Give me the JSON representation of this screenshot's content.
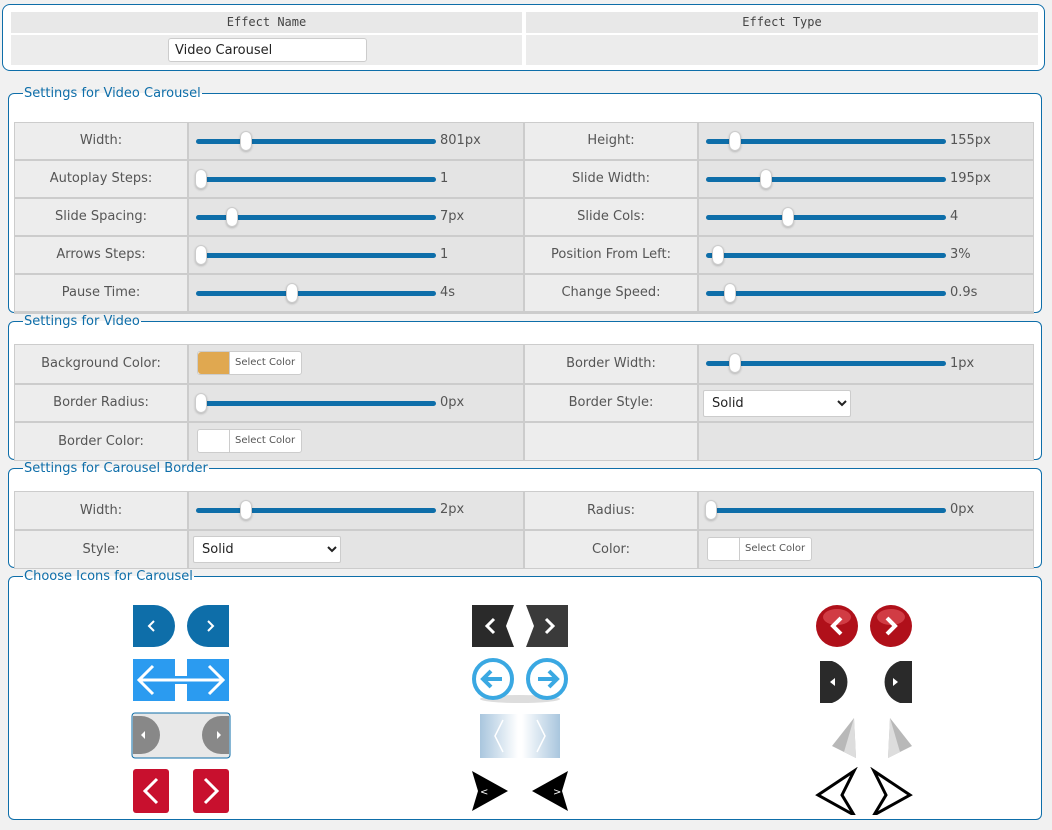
{
  "top": {
    "col1_header": "Effect Name",
    "col2_header": "Effect Type",
    "effect_name": "Video Carousel",
    "effect_type": ""
  },
  "carousel": {
    "legend": "Settings for Video Carousel",
    "rows": [
      {
        "l_label": "Width:",
        "l_value": "801px",
        "l_pos": 0.21,
        "r_label": "Height:",
        "r_value": "155px",
        "r_pos": 0.12
      },
      {
        "l_label": "Autoplay Steps:",
        "l_value": "1",
        "l_pos": 0.02,
        "r_label": "Slide Width:",
        "r_value": "195px",
        "r_pos": 0.25
      },
      {
        "l_label": "Slide Spacing:",
        "l_value": "7px",
        "l_pos": 0.15,
        "r_label": "Slide Cols:",
        "r_value": "4",
        "r_pos": 0.34
      },
      {
        "l_label": "Arrows Steps:",
        "l_value": "1",
        "l_pos": 0.02,
        "r_label": "Position From Left:",
        "r_value": "3%",
        "r_pos": 0.05
      },
      {
        "l_label": "Pause Time:",
        "l_value": "4s",
        "l_pos": 0.4,
        "r_label": "Change Speed:",
        "r_value": "0.9s",
        "r_pos": 0.1
      }
    ]
  },
  "video": {
    "legend": "Settings for Video",
    "bg_label": "Background Color:",
    "bg_color": "#e0a850",
    "select_color": "Select Color",
    "bw_label": "Border Width:",
    "bw_value": "1px",
    "bw_pos": 0.12,
    "br_label": "Border Radius:",
    "br_value": "0px",
    "br_pos": 0.02,
    "bs_label": "Border Style:",
    "bs_value": "Solid",
    "bc_label": "Border Color:",
    "bc_color": "#ffffff"
  },
  "border": {
    "legend": "Settings for Carousel Border",
    "w_label": "Width:",
    "w_value": "2px",
    "w_pos": 0.21,
    "r_label": "Radius:",
    "r_value": "0px",
    "r_pos": 0.02,
    "s_label": "Style:",
    "s_value": "Solid",
    "c_label": "Color:",
    "c_color": "#ffffff"
  },
  "icons": {
    "legend": "Choose Icons for Carousel",
    "items": [
      "blue-rounded-arrows-icon",
      "black-chevron-arrows-icon",
      "red-glossy-circle-arrows-icon",
      "blue-long-arrows-icon",
      "blue-circle-arrows-icon",
      "black-half-round-arrows-icon",
      "gray-half-circle-arrows-icon",
      "light-blue-thin-arrows-icon",
      "thin-gray-needle-arrows-icon",
      "red-square-arrows-icon",
      "black-triangle-arrows-icon",
      "black-outline-pointer-arrows-icon"
    ],
    "glyph_left": "<",
    "glyph_right": ">"
  }
}
